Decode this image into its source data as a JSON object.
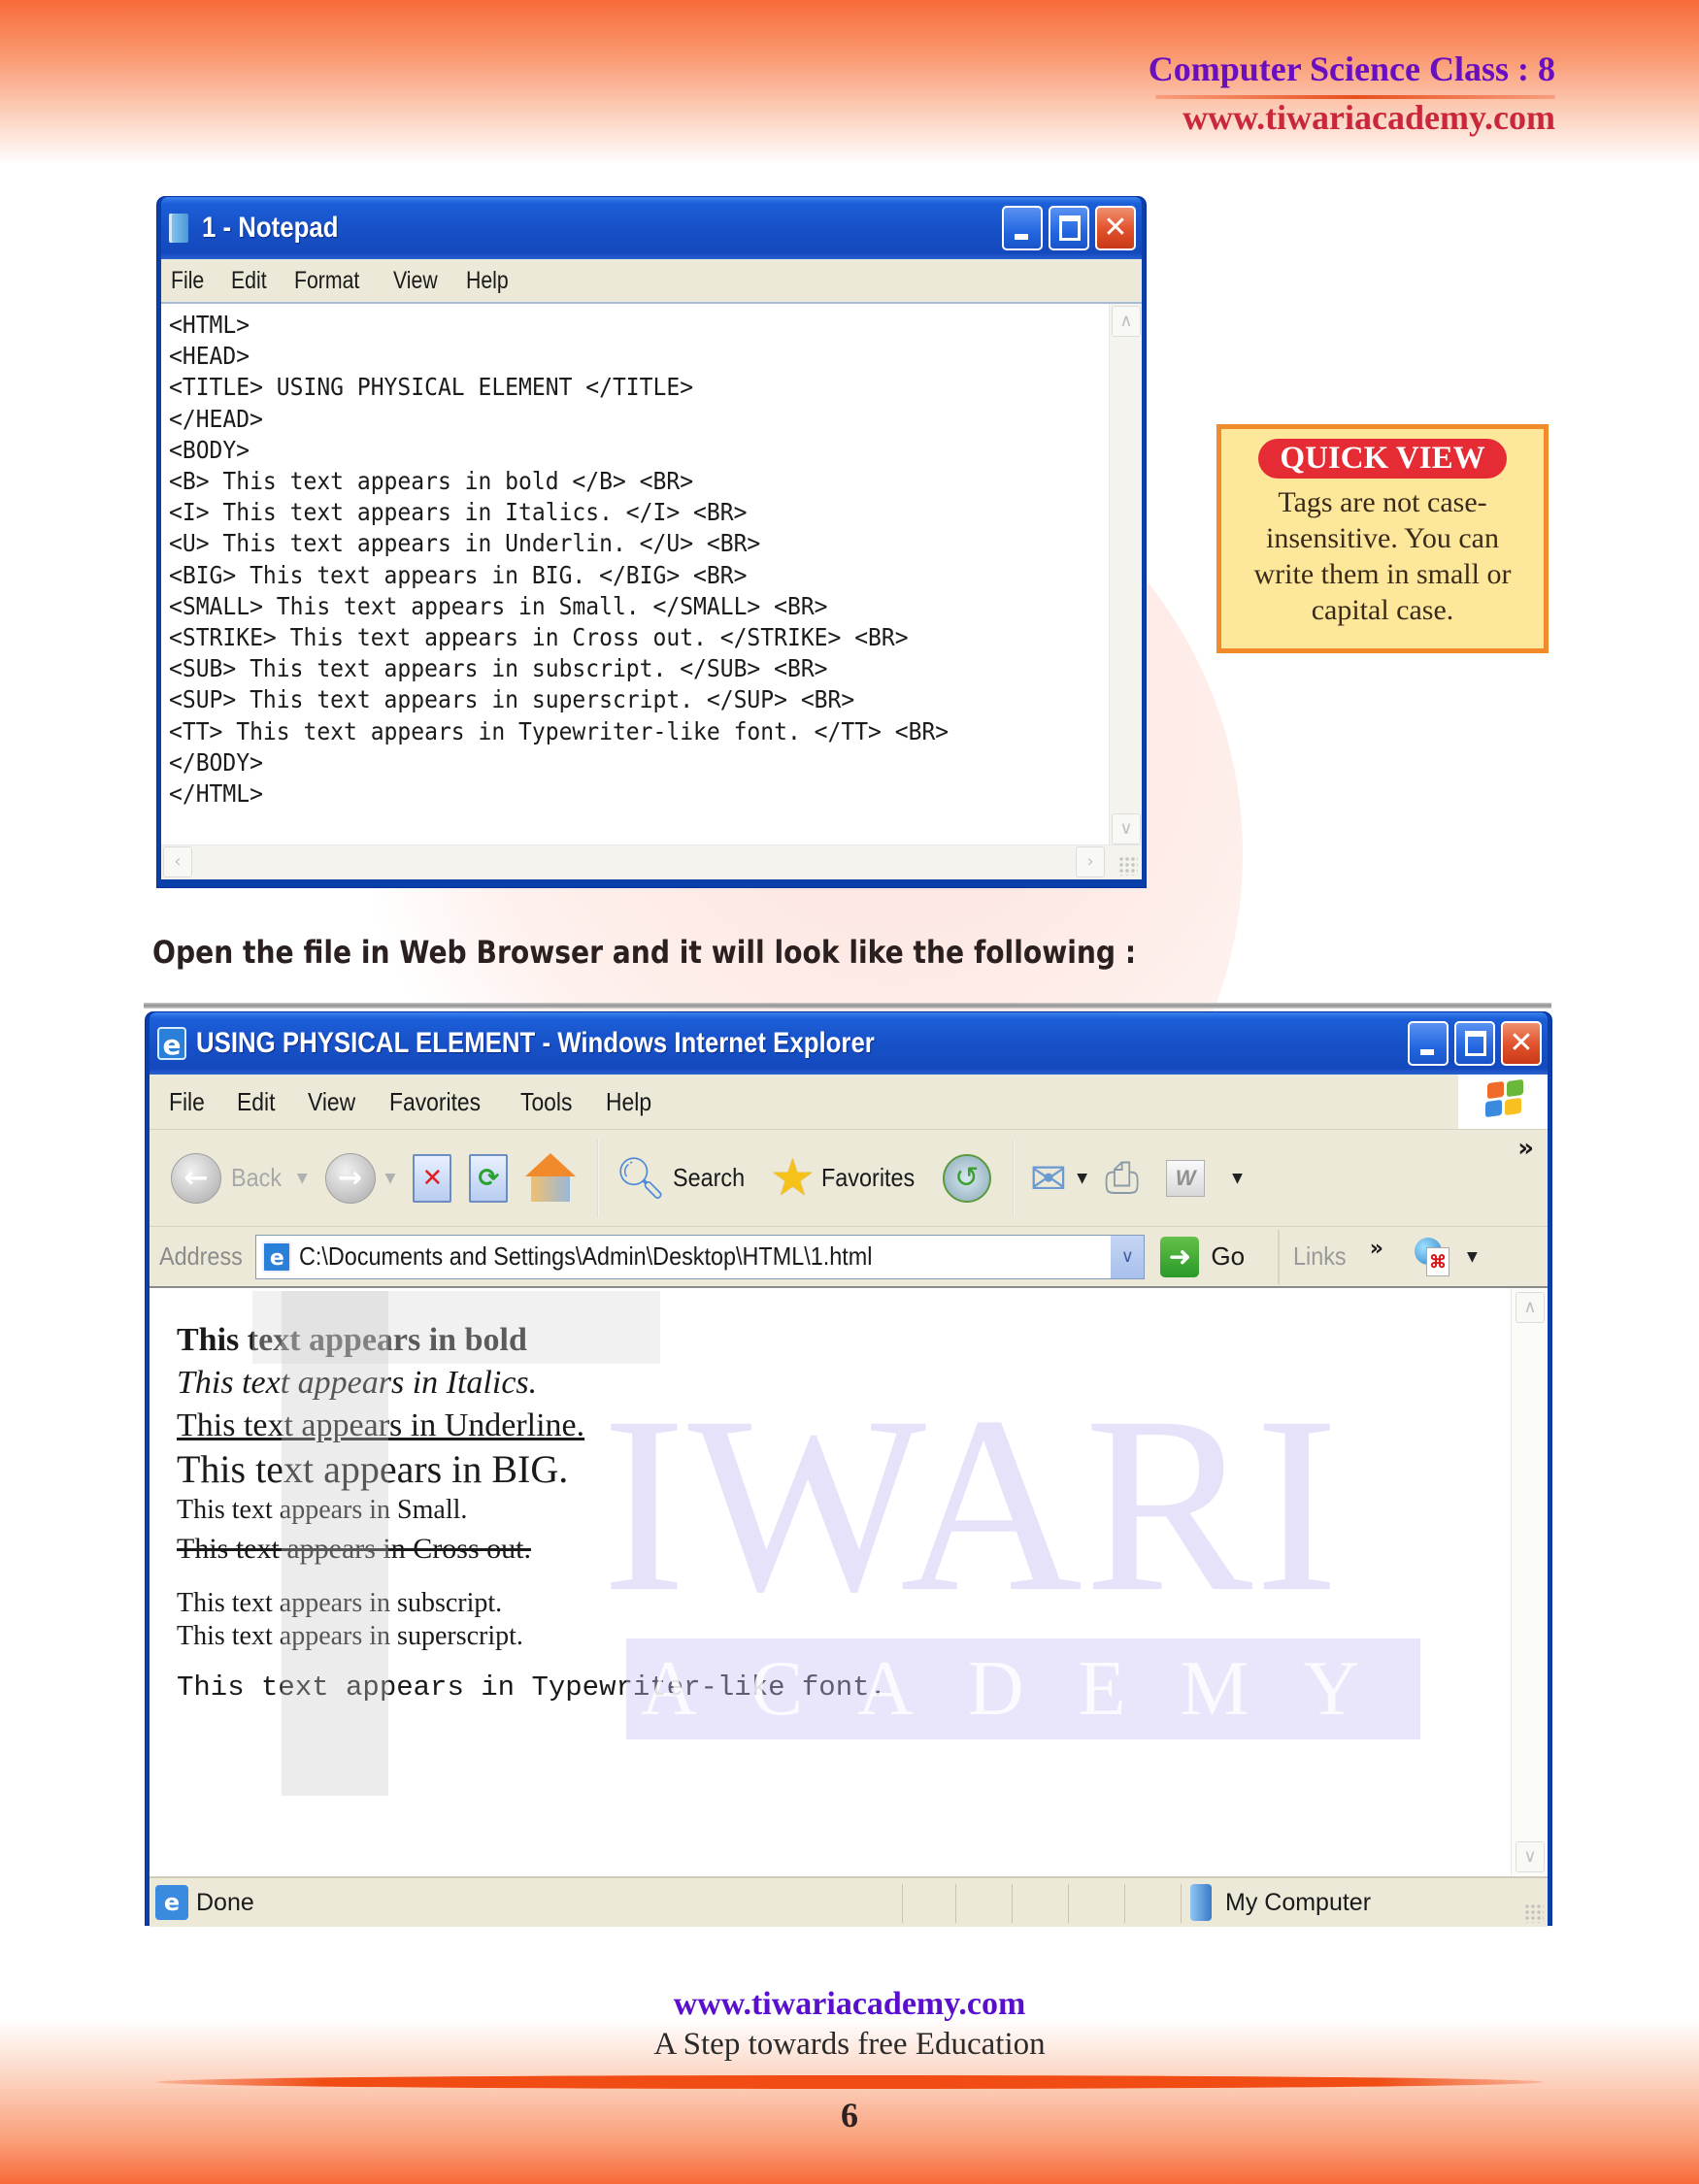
{
  "header": {
    "title": "Computer Science Class : 8",
    "url": "www.tiwariacademy.com"
  },
  "watermark": {
    "word1": "IWARI",
    "word2": "ACADEMY"
  },
  "notepad": {
    "title": "1 - Notepad",
    "menu": [
      "File",
      "Edit",
      "Format",
      "View",
      "Help"
    ],
    "lines": [
      "<HTML>",
      "<HEAD>",
      "<TITLE> USING PHYSICAL ELEMENT </TITLE>",
      "</HEAD>",
      "<BODY>",
      "<B> This text appears in bold </B> <BR>",
      "<I> This text appears in Italics. </I> <BR>",
      "<U> This text appears in Underlin. </U> <BR>",
      "<BIG> This text appears in BIG. </BIG> <BR>",
      "<SMALL> This text appears in Small. </SMALL> <BR>",
      "<STRIKE> This text appears in Cross out. </STRIKE> <BR>",
      "<SUB> This text appears in subscript. </SUB> <BR>",
      "<SUP> This text appears in superscript. </SUP> <BR>",
      "<TT> This text appears in Typewriter-like font. </TT> <BR>",
      "</BODY>",
      "</HTML>"
    ]
  },
  "quick_view": {
    "badge": "QUICK VIEW",
    "text": "Tags are not case-insensitive. You can write them in small or capital case."
  },
  "instruction": "Open the file in Web Browser and it will look like the following :",
  "browser": {
    "title": "USING PHYSICAL ELEMENT - Windows Internet Explorer",
    "menu": [
      "File",
      "Edit",
      "View",
      "Favorites",
      "Tools",
      "Help"
    ],
    "toolbar": {
      "back": "Back",
      "search": "Search",
      "favorites": "Favorites",
      "more": "»"
    },
    "address": {
      "label": "Address",
      "value": "C:\\Documents and Settings\\Admin\\Desktop\\HTML\\1.html",
      "go": "Go",
      "links": "Links",
      "links_more": "»"
    },
    "content": {
      "bold": "This text appears in bold",
      "italic": "This text appears in Italics.",
      "underline": "This text appears in Underline.",
      "big": "This text appears in BIG.",
      "small": "This text appears in Small.",
      "strike": "This text appears in Cross out.",
      "subscript": "This text appears in subscript.",
      "superscript": "This text appears in superscript.",
      "typewriter": "This text appears in Typewriter-like font."
    },
    "status": {
      "text": "Done",
      "zone": "My Computer"
    }
  },
  "footer": {
    "url": "www.tiwariacademy.com",
    "tagline": "A Step towards free Education",
    "page_number": "6"
  },
  "colors": {
    "brand_purple": "#6a0fbf",
    "brand_red": "#c8283a",
    "accent_orange": "#f04c14",
    "xp_blue": "#1751c8",
    "quick_view_badge": "#e52c35",
    "quick_view_bg": "#fde79a"
  }
}
